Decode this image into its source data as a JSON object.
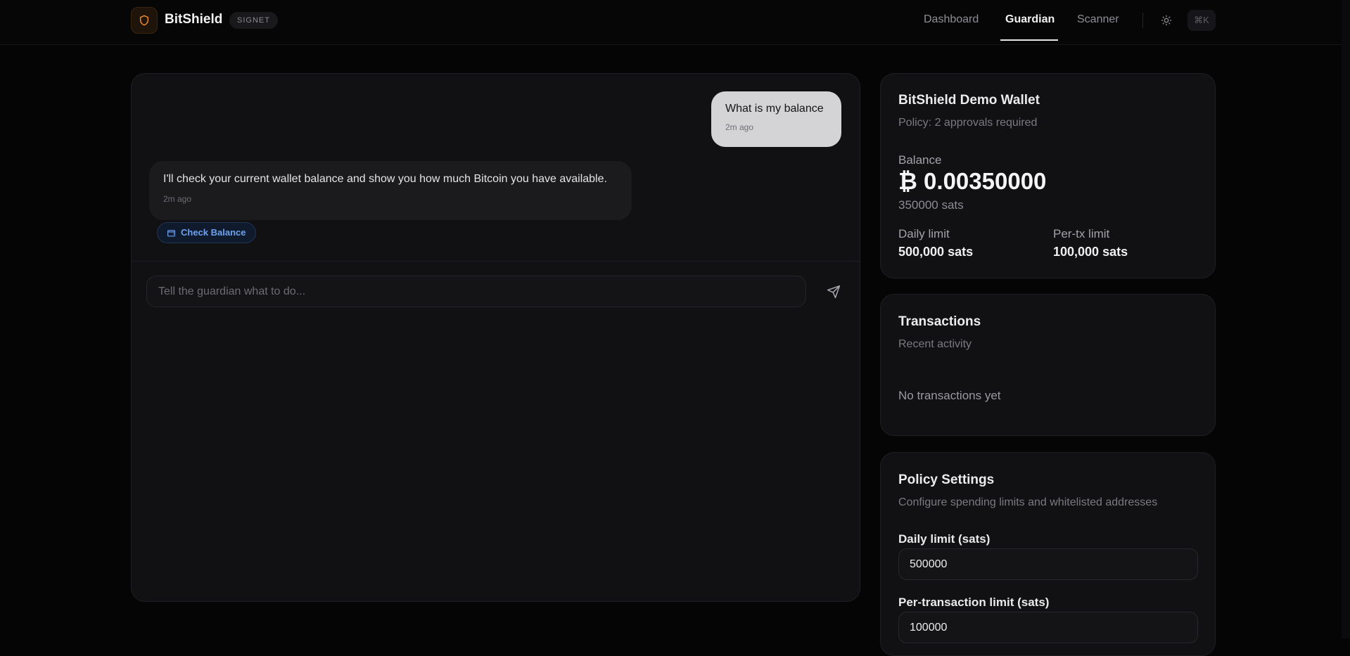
{
  "header": {
    "brand": "BitShield",
    "network_badge": "SIGNET",
    "nav": [
      {
        "label": "Dashboard",
        "active": false
      },
      {
        "label": "Guardian",
        "active": true
      },
      {
        "label": "Scanner",
        "active": false
      }
    ],
    "shortcut": "⌘K",
    "icons": {
      "logo": "shield-icon",
      "theme": "sun-icon"
    },
    "accent_color": "#f0892b"
  },
  "chat": {
    "messages": [
      {
        "role": "user",
        "text": "What is my balance",
        "time": "2m ago"
      },
      {
        "role": "assistant",
        "text": "I'll check your current wallet balance and show you how much Bitcoin you have available.",
        "time": "2m ago"
      }
    ],
    "tool_chip": {
      "label": "Check Balance",
      "icon": "wallet-icon",
      "color": "#6da0ee"
    },
    "input_placeholder": "Tell the guardian what to do...",
    "send_icon": "send-icon"
  },
  "wallet": {
    "title": "BitShield Demo Wallet",
    "policy": "Policy: 2 approvals required",
    "balance_label": "Balance",
    "balance_btc": "₿ 0.00350000",
    "balance_sats": "350000 sats",
    "daily_limit_label": "Daily limit",
    "daily_limit_value": "500,000 sats",
    "per_tx_label": "Per-tx limit",
    "per_tx_value": "100,000 sats"
  },
  "transactions": {
    "title": "Transactions",
    "subtitle": "Recent activity",
    "empty": "No transactions yet"
  },
  "policy_settings": {
    "title": "Policy Settings",
    "subtitle": "Configure spending limits and whitelisted addresses",
    "daily_limit_label": "Daily limit (sats)",
    "daily_limit_value": "500000",
    "per_tx_label": "Per-transaction limit (sats)",
    "per_tx_value": "100000"
  }
}
